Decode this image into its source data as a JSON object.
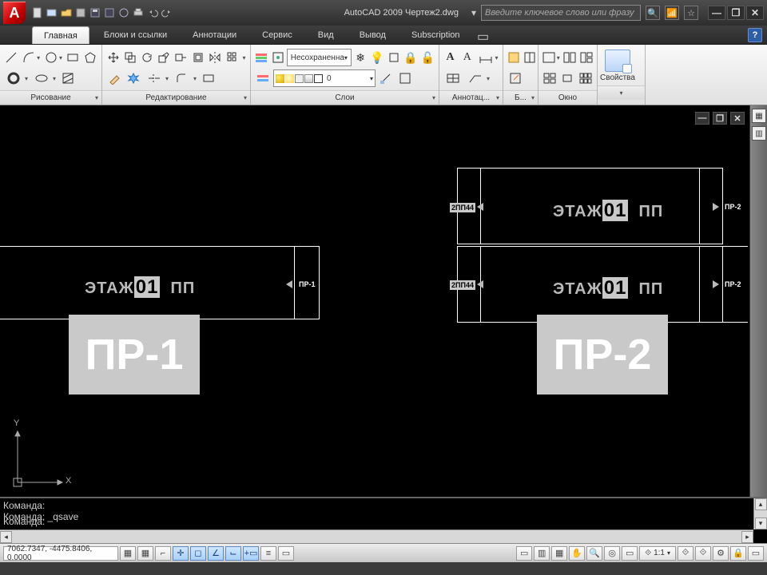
{
  "titlebar": {
    "app": "AutoCAD 2009",
    "doc": "Чертеж2.dwg",
    "search_placeholder": "Введите ключевое слово или фразу"
  },
  "tabs": [
    {
      "label": "Главная",
      "active": true
    },
    {
      "label": "Блоки и ссылки"
    },
    {
      "label": "Аннотации"
    },
    {
      "label": "Сервис"
    },
    {
      "label": "Вид"
    },
    {
      "label": "Вывод"
    },
    {
      "label": "Subscription"
    }
  ],
  "panels": {
    "draw": "Рисование",
    "modify": "Редактирование",
    "layers": "Слои",
    "annotate": "Аннотац...",
    "block": "Б...",
    "window": "Окно",
    "properties_btn": "Свойства",
    "layer_state": "Несохраненна",
    "current_layer": "0"
  },
  "drawing": {
    "floor_label_prefix": "ЭТАЖ",
    "floor_number": "01",
    "pp": "ПП",
    "tag_left": "2ПП44",
    "pr1_mark": "ПР-1",
    "pr2_mark": "ПР-2",
    "pr1_big": "ПР-1",
    "pr2_big": "ПР-2"
  },
  "ucs": {
    "x": "X",
    "y": "Y"
  },
  "command": {
    "line1": "Команда:",
    "line2": "Команда: _qsave",
    "prompt": "Команда:"
  },
  "status": {
    "coords": "7062.7347, -4475.8406, 0.0000",
    "anno_scale": "1:1"
  }
}
